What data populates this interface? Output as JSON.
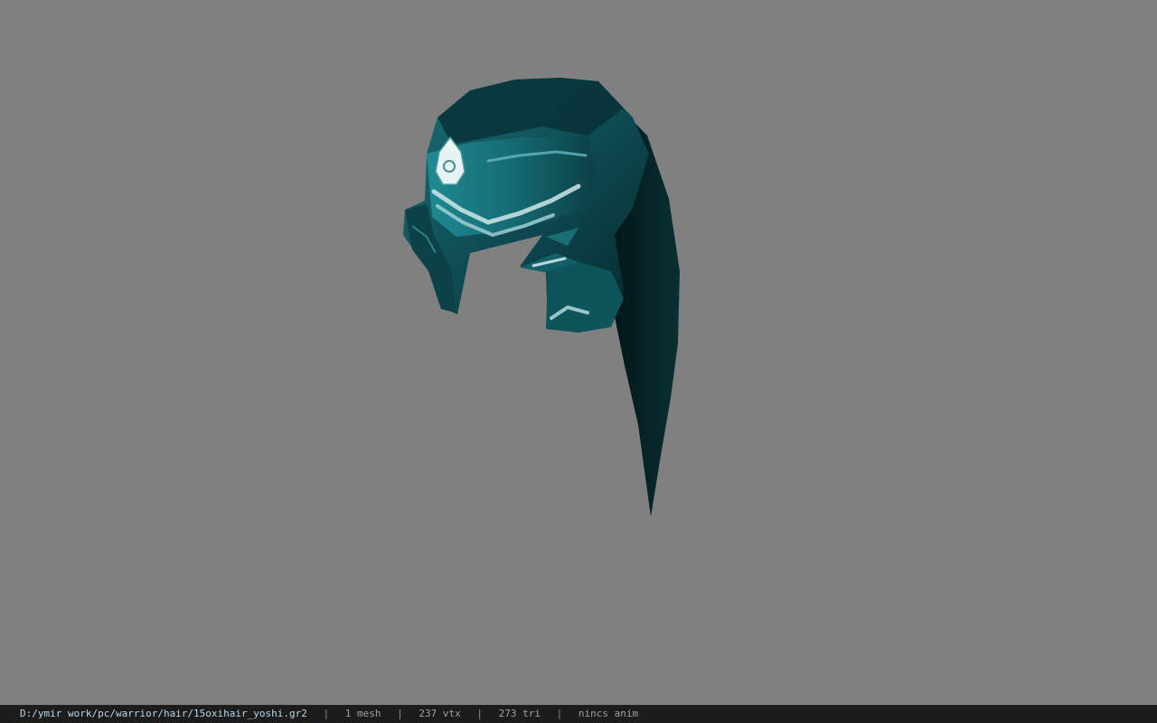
{
  "viewport": {
    "background_color": "#808080",
    "model_colors": {
      "hair_dark": "#031516",
      "hair_mid": "#0f5560",
      "hair_light": "#1c7e86",
      "ornament": "#dff0f0"
    }
  },
  "status_bar": {
    "file_path": "D:/ymir work/pc/warrior/hair/15oxihair_yoshi.gr2",
    "separator": "|",
    "mesh_count": "1 mesh",
    "vertex_count": "237 vtx",
    "triangle_count": "273 tri",
    "animation_info": "nincs anim"
  }
}
